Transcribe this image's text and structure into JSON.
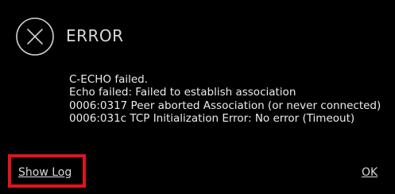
{
  "dialog": {
    "title": "ERROR",
    "icon": "close-circle-icon",
    "messages": [
      "C-ECHO failed.",
      "Echo failed: Failed to establish association",
      "0006:0317 Peer aborted Association (or never connected)",
      "0006:031c TCP Initialization Error: No error (Timeout)"
    ],
    "show_log_label": "Show Log",
    "ok_label": "OK"
  },
  "colors": {
    "background": "#000000",
    "text": "#ececec",
    "highlight": "#e0141e"
  }
}
